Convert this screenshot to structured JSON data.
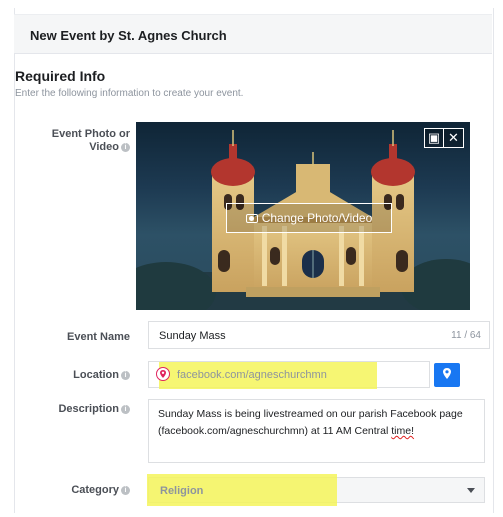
{
  "dialog": {
    "title": "New Event by St. Agnes Church"
  },
  "section": {
    "title": "Required Info",
    "subtitle": "Enter the following information to create your event."
  },
  "photo": {
    "label": "Event Photo or Video",
    "change_label": "Change Photo/Video",
    "crop_icon": "crop-icon",
    "close_icon": "close-icon",
    "camera_icon": "camera-icon"
  },
  "event_name": {
    "label": "Event Name",
    "value": "Sunday Mass",
    "counter": "11 / 64"
  },
  "location": {
    "label": "Location",
    "value": "facebook.com/agneschurchmn",
    "pin_icon": "map-pin-icon",
    "map_icon": "map-marker-icon"
  },
  "description": {
    "label": "Description",
    "text_before": "Sunday Mass is being livestreamed on our parish Facebook page (facebook.com/agneschurchmn) at 11 AM Central ",
    "text_misspelled": "time!"
  },
  "category": {
    "label": "Category",
    "value": "Religion",
    "dropdown_icon": "chevron-down-icon"
  },
  "colors": {
    "highlight": "#f4f55a",
    "accent": "#1877f2",
    "pin": "#e0245e"
  }
}
